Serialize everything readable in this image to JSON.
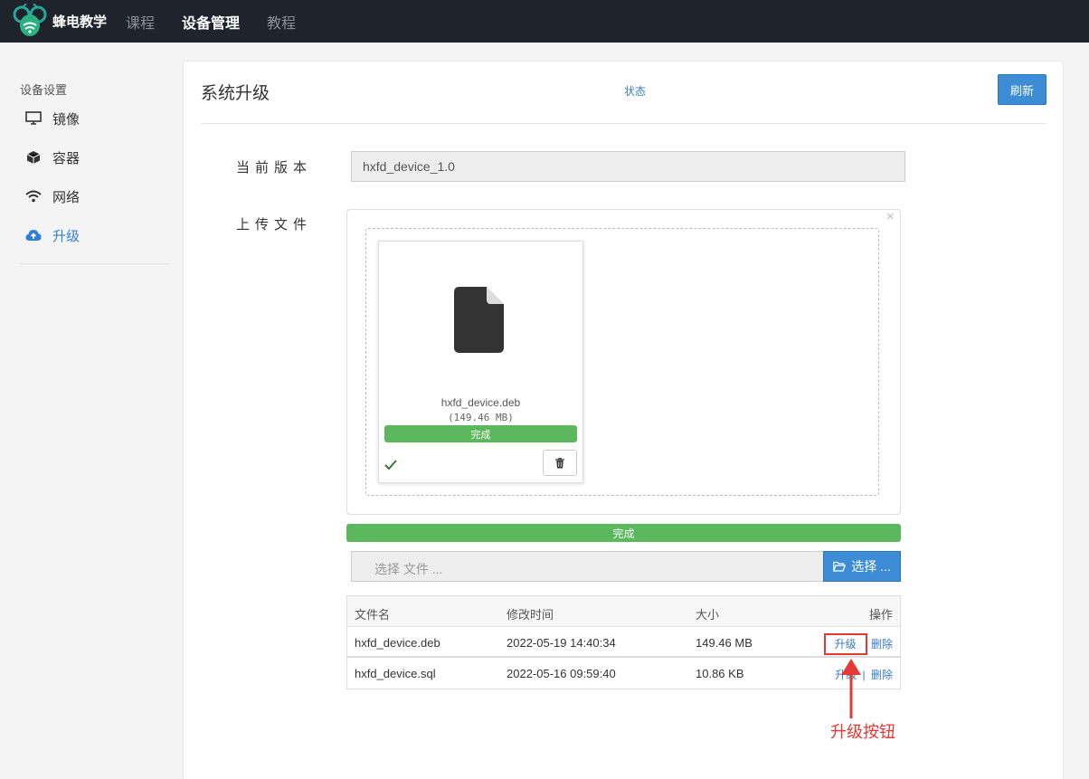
{
  "topnav": {
    "brand": "蜂电教学",
    "items": [
      "课程",
      "设备管理",
      "教程"
    ]
  },
  "sidebar": {
    "title": "设备设置",
    "items": [
      {
        "label": "镜像",
        "icon": "monitor-icon"
      },
      {
        "label": "容器",
        "icon": "box-icon"
      },
      {
        "label": "网络",
        "icon": "wifi-icon"
      },
      {
        "label": "升级",
        "icon": "cloud-upload-icon",
        "active": true
      }
    ]
  },
  "main": {
    "title": "系统升级",
    "status_link": "状态",
    "refresh_label": "刷新",
    "current_version_label": "当前版本",
    "current_version_value": "hxfd_device_1.0",
    "upload_label": "上传文件",
    "upload_close": "×",
    "preview": {
      "file_name": "hxfd_device.deb",
      "file_size": "(149.46 MB)",
      "progress_label": "完成",
      "progress": 1.0
    },
    "total_progress_label": "完成",
    "total_progress": 1.0,
    "file_input_placeholder": "选择 文件 ...",
    "browse_label": "选择 ..."
  },
  "table": {
    "headers": [
      "文件名",
      "修改时间",
      "大小",
      "操作"
    ],
    "rows": [
      {
        "name": "hxfd_device.deb",
        "time": "2022-05-19 14:40:34",
        "size": "149.46 MB",
        "upgrade": "升级",
        "delete": "删除",
        "sep": ""
      },
      {
        "name": "hxfd_device.sql",
        "time": "2022-05-16 09:59:40",
        "size": "10.86 KB",
        "upgrade": "升级",
        "delete": "删除",
        "sep": "|"
      }
    ]
  },
  "annotation": {
    "text": "升级按钮",
    "color": "#e53935"
  },
  "colors": {
    "accent": "#3c8dd6",
    "success": "#5cb85c",
    "nav_bg": "#1f232b"
  }
}
